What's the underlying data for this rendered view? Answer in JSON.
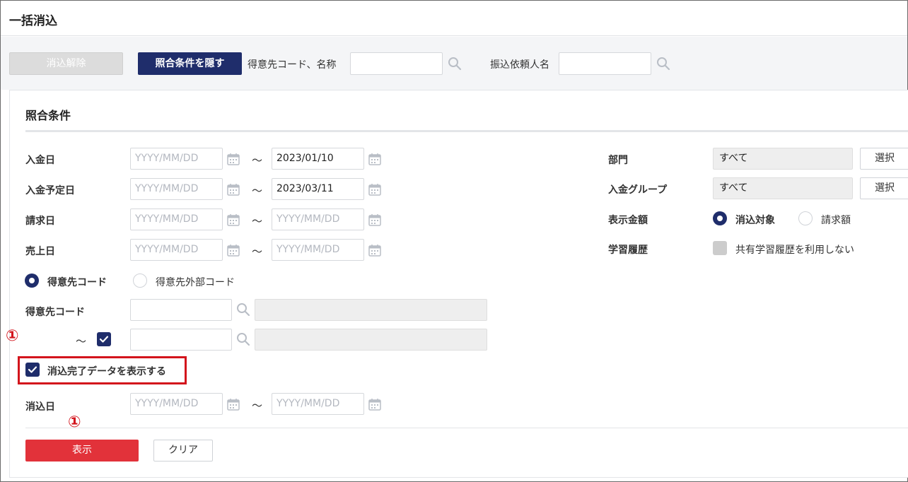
{
  "header": {
    "title": "一括消込"
  },
  "toolbar": {
    "unclear_label": "消込解除",
    "toggle_conditions_label": "照合条件を隠す",
    "customer_label": "得意先コード、名称",
    "customer_value": "",
    "transferer_label": "振込依頼人名",
    "transferer_value": ""
  },
  "conditions": {
    "title": "照合条件",
    "date_rows": [
      {
        "label": "入金日",
        "from": "",
        "to": "2023/01/10"
      },
      {
        "label": "入金予定日",
        "from": "",
        "to": "2023/03/11"
      },
      {
        "label": "請求日",
        "from": "",
        "to": ""
      },
      {
        "label": "売上日",
        "from": "",
        "to": ""
      }
    ],
    "date_placeholder": "YYYY/MM/DD",
    "range_sep": "～",
    "code_type": {
      "options": [
        "得意先コード",
        "得意先外部コード"
      ],
      "selected": "得意先コード"
    },
    "customer_code": {
      "label": "得意先コード",
      "range_checked": true
    },
    "show_cleared": {
      "label": "消込完了データを表示する",
      "checked": true
    },
    "clear_date": {
      "label": "消込日",
      "from": "",
      "to": ""
    },
    "right": {
      "department": {
        "label": "部門",
        "value": "すべて",
        "button": "選択"
      },
      "group": {
        "label": "入金グループ",
        "value": "すべて",
        "button": "選択"
      },
      "amount": {
        "label": "表示金額",
        "options": [
          "消込対象",
          "請求額"
        ],
        "selected": "消込対象"
      },
      "learning": {
        "label": "学習履歴",
        "checkbox_label": "共有学習履歴を利用しない",
        "checked": false
      }
    }
  },
  "actions": {
    "show_label": "表示",
    "clear_label": "クリア"
  },
  "annotations": {
    "marker": "①"
  },
  "colors": {
    "navy": "#1f2d6b",
    "red": "#e2323a",
    "annotation_red": "#d3141c"
  },
  "icons": [
    "search-icon",
    "calendar-icon",
    "check-icon"
  ]
}
